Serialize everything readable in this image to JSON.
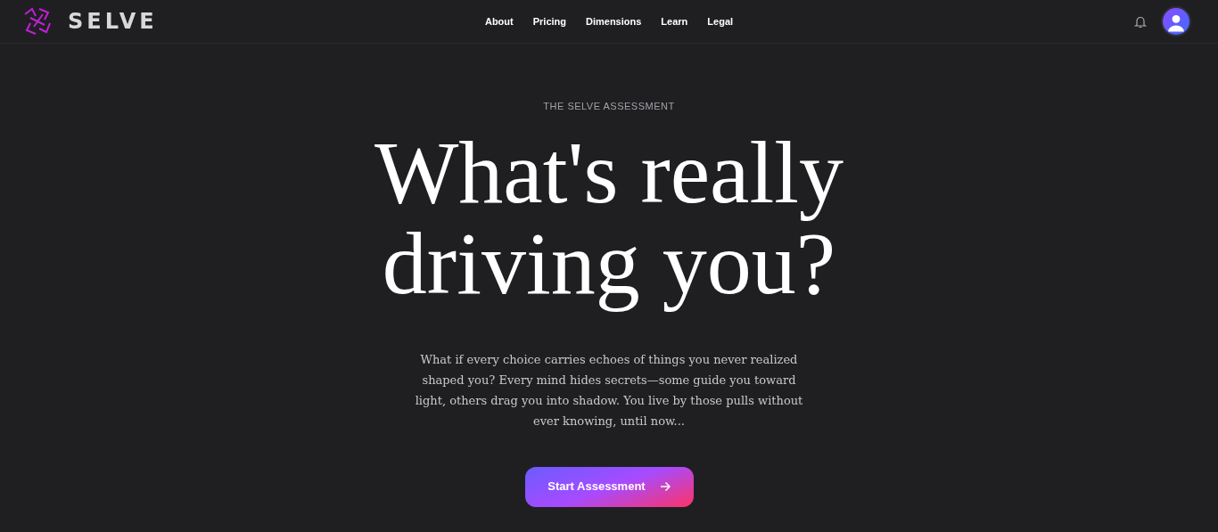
{
  "brand": {
    "name": "SELVE"
  },
  "nav": [
    {
      "label": "About"
    },
    {
      "label": "Pricing"
    },
    {
      "label": "Dimensions"
    },
    {
      "label": "Learn"
    },
    {
      "label": "Legal"
    }
  ],
  "hero": {
    "eyebrow": "THE SELVE ASSESSMENT",
    "title_lines": [
      "What's really",
      "driving you?"
    ],
    "lead": "What if every choice carries echoes of things you never realized shaped you? Every mind hides secrets—some guide you toward light, others drag you into shadow. You live by those pulls without ever knowing, until now...",
    "cta": "Start Assessment"
  }
}
